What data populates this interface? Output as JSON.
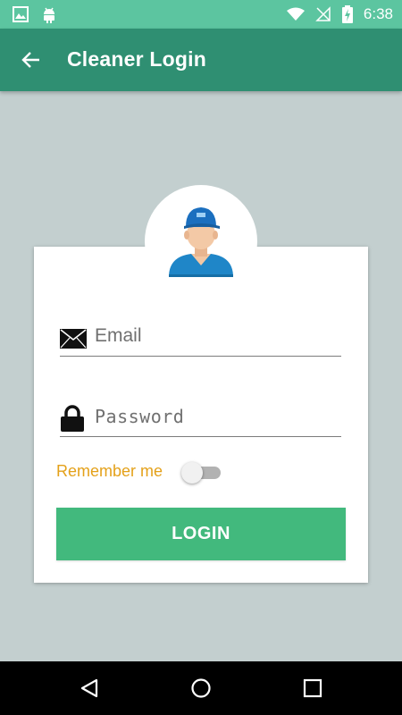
{
  "status_bar": {
    "time": "6:38",
    "icons": [
      "image-icon",
      "android-icon",
      "wifi-icon",
      "no-signal-icon",
      "battery-charging-icon"
    ]
  },
  "app_bar": {
    "title": "Cleaner Login",
    "back_icon": "back-arrow-icon"
  },
  "login": {
    "avatar_icon": "cleaner-avatar-icon",
    "email_placeholder": "Email",
    "email_value": "",
    "password_placeholder": "Password",
    "password_value": "",
    "remember_label": "Remember me",
    "remember_on": false,
    "button_label": "LOGIN"
  },
  "colors": {
    "status_bar": "#5cc5a0",
    "app_bar": "#2f8f72",
    "background": "#c3cfcf",
    "button": "#42b97d",
    "remember_text": "#e4a11a"
  },
  "nav_bar": {
    "icons": [
      "back-triangle-icon",
      "home-circle-icon",
      "recents-square-icon"
    ]
  }
}
